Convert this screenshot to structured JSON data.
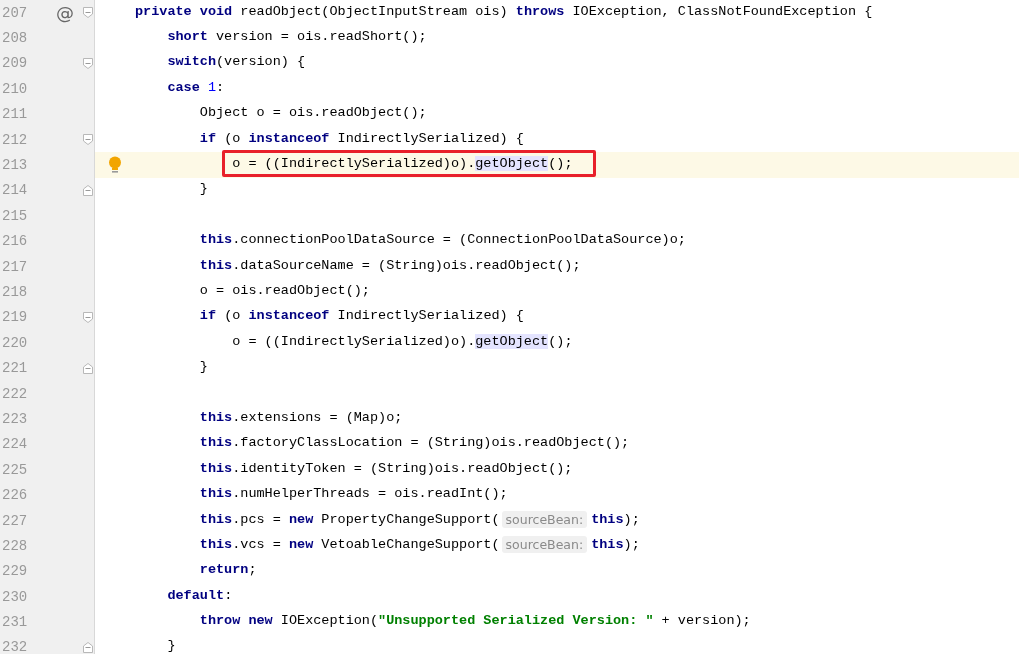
{
  "editor": {
    "lines": [
      {
        "number": "207",
        "gutter_mark": "@",
        "fold_start": true,
        "tokens": [
          {
            "kind": "keyword",
            "text": "private void "
          },
          {
            "kind": "plain",
            "text": "readObject(ObjectInputStream ois) "
          },
          {
            "kind": "keyword",
            "text": "throws "
          },
          {
            "kind": "plain",
            "text": "IOException, ClassNotFoundException {"
          }
        ]
      },
      {
        "number": "208",
        "tokens": [
          {
            "kind": "keyword",
            "text": "    short "
          },
          {
            "kind": "plain",
            "text": "version = ois.readShort();"
          }
        ]
      },
      {
        "number": "209",
        "fold_start": true,
        "tokens": [
          {
            "kind": "keyword",
            "text": "    switch"
          },
          {
            "kind": "plain",
            "text": "(version) {"
          }
        ]
      },
      {
        "number": "210",
        "tokens": [
          {
            "kind": "keyword",
            "text": "    case "
          },
          {
            "kind": "number",
            "text": "1"
          },
          {
            "kind": "plain",
            "text": ":"
          }
        ]
      },
      {
        "number": "211",
        "tokens": [
          {
            "kind": "plain",
            "text": "        Object o = ois.readObject();"
          }
        ]
      },
      {
        "number": "212",
        "fold_start": true,
        "tokens": [
          {
            "kind": "keyword",
            "text": "        if "
          },
          {
            "kind": "plain",
            "text": "(o "
          },
          {
            "kind": "keyword",
            "text": "instanceof "
          },
          {
            "kind": "plain",
            "text": "IndirectlySerialized) {"
          }
        ]
      },
      {
        "number": "213",
        "current": true,
        "bulb": true,
        "boxed": true,
        "tokens": [
          {
            "kind": "plain",
            "text": "            o = ((IndirectlySerialized)o)."
          },
          {
            "kind": "usage",
            "text": "getObject"
          },
          {
            "kind": "plain",
            "text": "();"
          }
        ]
      },
      {
        "number": "214",
        "fold_end": true,
        "tokens": [
          {
            "kind": "plain",
            "text": "        }"
          }
        ]
      },
      {
        "number": "215"
      },
      {
        "number": "216",
        "tokens": [
          {
            "kind": "keyword",
            "text": "        this"
          },
          {
            "kind": "plain",
            "text": ".connectionPoolDataSource = (ConnectionPoolDataSource)o;"
          }
        ]
      },
      {
        "number": "217",
        "tokens": [
          {
            "kind": "keyword",
            "text": "        this"
          },
          {
            "kind": "plain",
            "text": ".dataSourceName = (String)ois.readObject();"
          }
        ]
      },
      {
        "number": "218",
        "tokens": [
          {
            "kind": "plain",
            "text": "        o = ois.readObject();"
          }
        ]
      },
      {
        "number": "219",
        "fold_start": true,
        "tokens": [
          {
            "kind": "keyword",
            "text": "        if "
          },
          {
            "kind": "plain",
            "text": "(o "
          },
          {
            "kind": "keyword",
            "text": "instanceof "
          },
          {
            "kind": "plain",
            "text": "IndirectlySerialized) {"
          }
        ]
      },
      {
        "number": "220",
        "tokens": [
          {
            "kind": "plain",
            "text": "            o = ((IndirectlySerialized)o)."
          },
          {
            "kind": "usage",
            "text": "getObject"
          },
          {
            "kind": "plain",
            "text": "();"
          }
        ]
      },
      {
        "number": "221",
        "fold_end": true,
        "tokens": [
          {
            "kind": "plain",
            "text": "        }"
          }
        ]
      },
      {
        "number": "222"
      },
      {
        "number": "223",
        "tokens": [
          {
            "kind": "keyword",
            "text": "        this"
          },
          {
            "kind": "plain",
            "text": ".extensions = (Map)o;"
          }
        ]
      },
      {
        "number": "224",
        "tokens": [
          {
            "kind": "keyword",
            "text": "        this"
          },
          {
            "kind": "plain",
            "text": ".factoryClassLocation = (String)ois.readObject();"
          }
        ]
      },
      {
        "number": "225",
        "tokens": [
          {
            "kind": "keyword",
            "text": "        this"
          },
          {
            "kind": "plain",
            "text": ".identityToken = (String)ois.readObject();"
          }
        ]
      },
      {
        "number": "226",
        "tokens": [
          {
            "kind": "keyword",
            "text": "        this"
          },
          {
            "kind": "plain",
            "text": ".numHelperThreads = ois.readInt();"
          }
        ]
      },
      {
        "number": "227",
        "tokens": [
          {
            "kind": "keyword",
            "text": "        this"
          },
          {
            "kind": "plain",
            "text": ".pcs = "
          },
          {
            "kind": "keyword",
            "text": "new "
          },
          {
            "kind": "plain",
            "text": "PropertyChangeSupport("
          },
          {
            "kind": "hint",
            "text": "sourceBean:"
          },
          {
            "kind": "keyword",
            "text": "this"
          },
          {
            "kind": "plain",
            "text": ");"
          }
        ]
      },
      {
        "number": "228",
        "tokens": [
          {
            "kind": "keyword",
            "text": "        this"
          },
          {
            "kind": "plain",
            "text": ".vcs = "
          },
          {
            "kind": "keyword",
            "text": "new "
          },
          {
            "kind": "plain",
            "text": "VetoableChangeSupport("
          },
          {
            "kind": "hint",
            "text": "sourceBean:"
          },
          {
            "kind": "keyword",
            "text": "this"
          },
          {
            "kind": "plain",
            "text": ");"
          }
        ]
      },
      {
        "number": "229",
        "tokens": [
          {
            "kind": "keyword",
            "text": "        return"
          },
          {
            "kind": "plain",
            "text": ";"
          }
        ]
      },
      {
        "number": "230",
        "tokens": [
          {
            "kind": "keyword",
            "text": "    default"
          },
          {
            "kind": "plain",
            "text": ":"
          }
        ]
      },
      {
        "number": "231",
        "tokens": [
          {
            "kind": "keyword",
            "text": "        throw new "
          },
          {
            "kind": "plain",
            "text": "IOException("
          },
          {
            "kind": "string",
            "text": "\"Unsupported Serialized Version: \""
          },
          {
            "kind": "plain",
            "text": " + version);"
          }
        ]
      },
      {
        "number": "232",
        "fold_end": true,
        "tokens": [
          {
            "kind": "plain",
            "text": "    }"
          }
        ]
      }
    ]
  }
}
